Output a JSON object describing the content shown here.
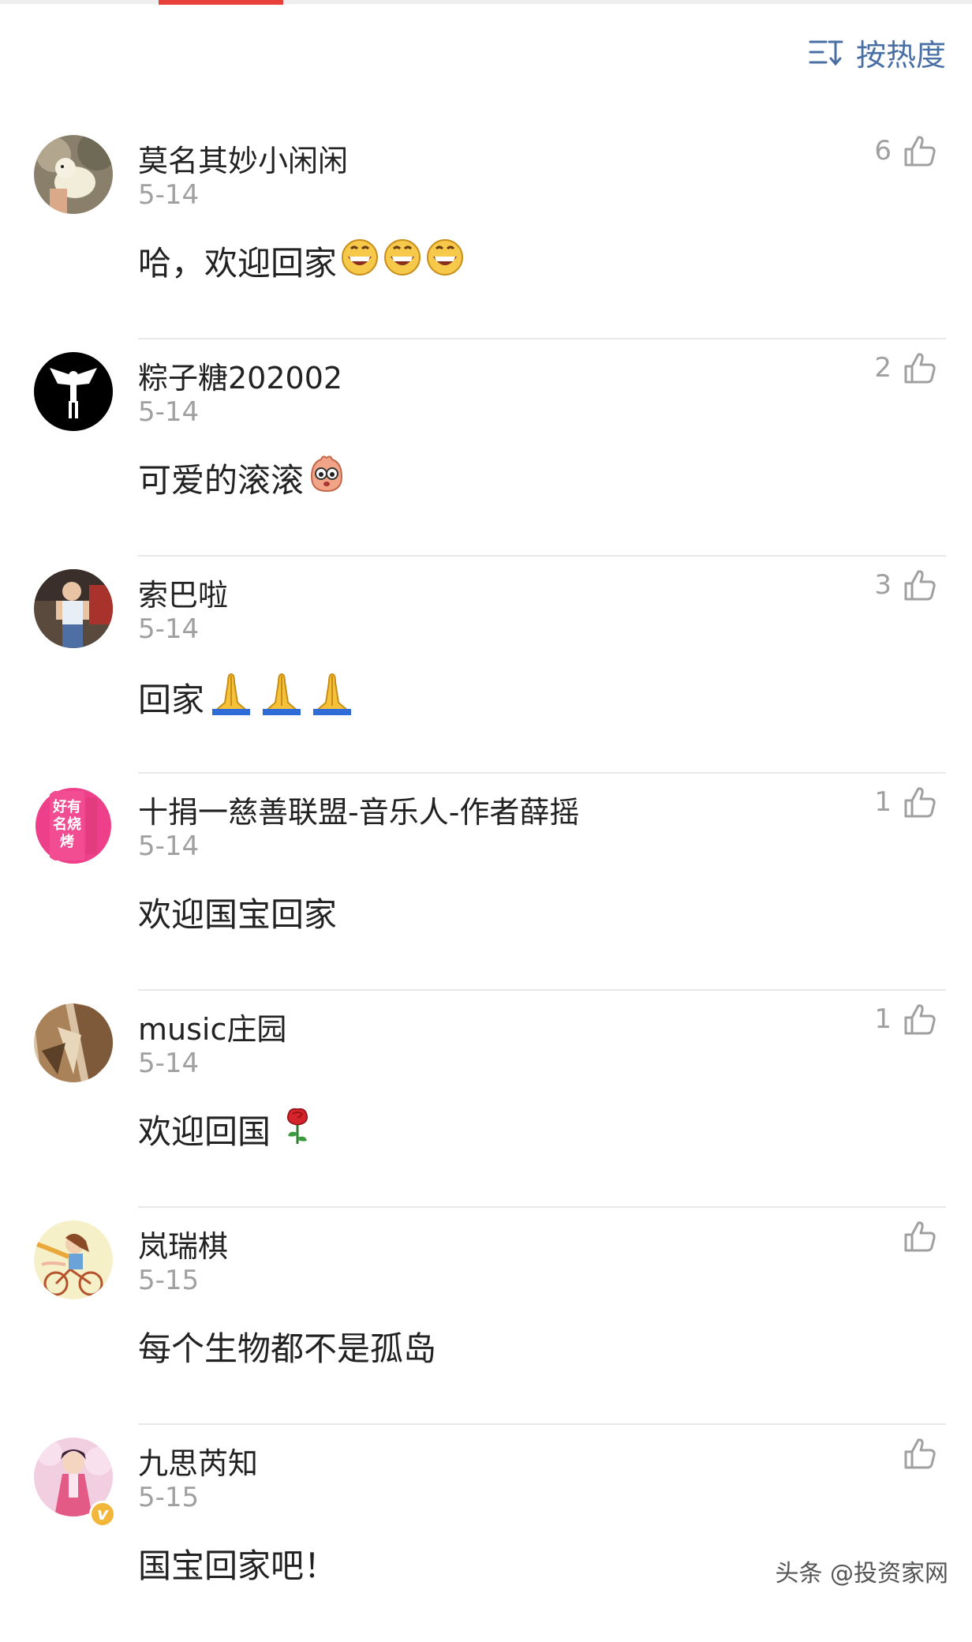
{
  "sort": {
    "label": "按热度",
    "icon": "sort-icon"
  },
  "colors": {
    "accent": "#e8403a",
    "link": "#4a6fa5",
    "muted": "#a0a0a0"
  },
  "comments": [
    {
      "name": "莫名其妙小闲闲",
      "date": "5-14",
      "text": "哈，欢迎回家",
      "emoji": "grinning-emoji",
      "likes": "6"
    },
    {
      "name": "粽子糖202002",
      "date": "5-14",
      "text": "可爱的滚滚",
      "emoji": "cute-face-emoji",
      "likes": "2"
    },
    {
      "name": "索巴啦",
      "date": "5-14",
      "text": "回家",
      "emoji": "praying-hands-emoji",
      "likes": "3"
    },
    {
      "name": "十捐一慈善联盟-音乐人-作者薛摇",
      "date": "5-14",
      "text": "欢迎国宝回家",
      "likes": "1",
      "avatar_text": "好有名烧烤"
    },
    {
      "name": "music庄园",
      "date": "5-14",
      "text": "欢迎回国",
      "emoji": "rose-emoji",
      "likes": "1"
    },
    {
      "name": "岚瑞棋",
      "date": "5-15",
      "text": "每个生物都不是孤岛",
      "likes": ""
    },
    {
      "name": "九思芮知",
      "date": "5-15",
      "text": "国宝回家吧！",
      "likes": "",
      "verified": true
    }
  ],
  "watermark": "头条 @投资家网"
}
